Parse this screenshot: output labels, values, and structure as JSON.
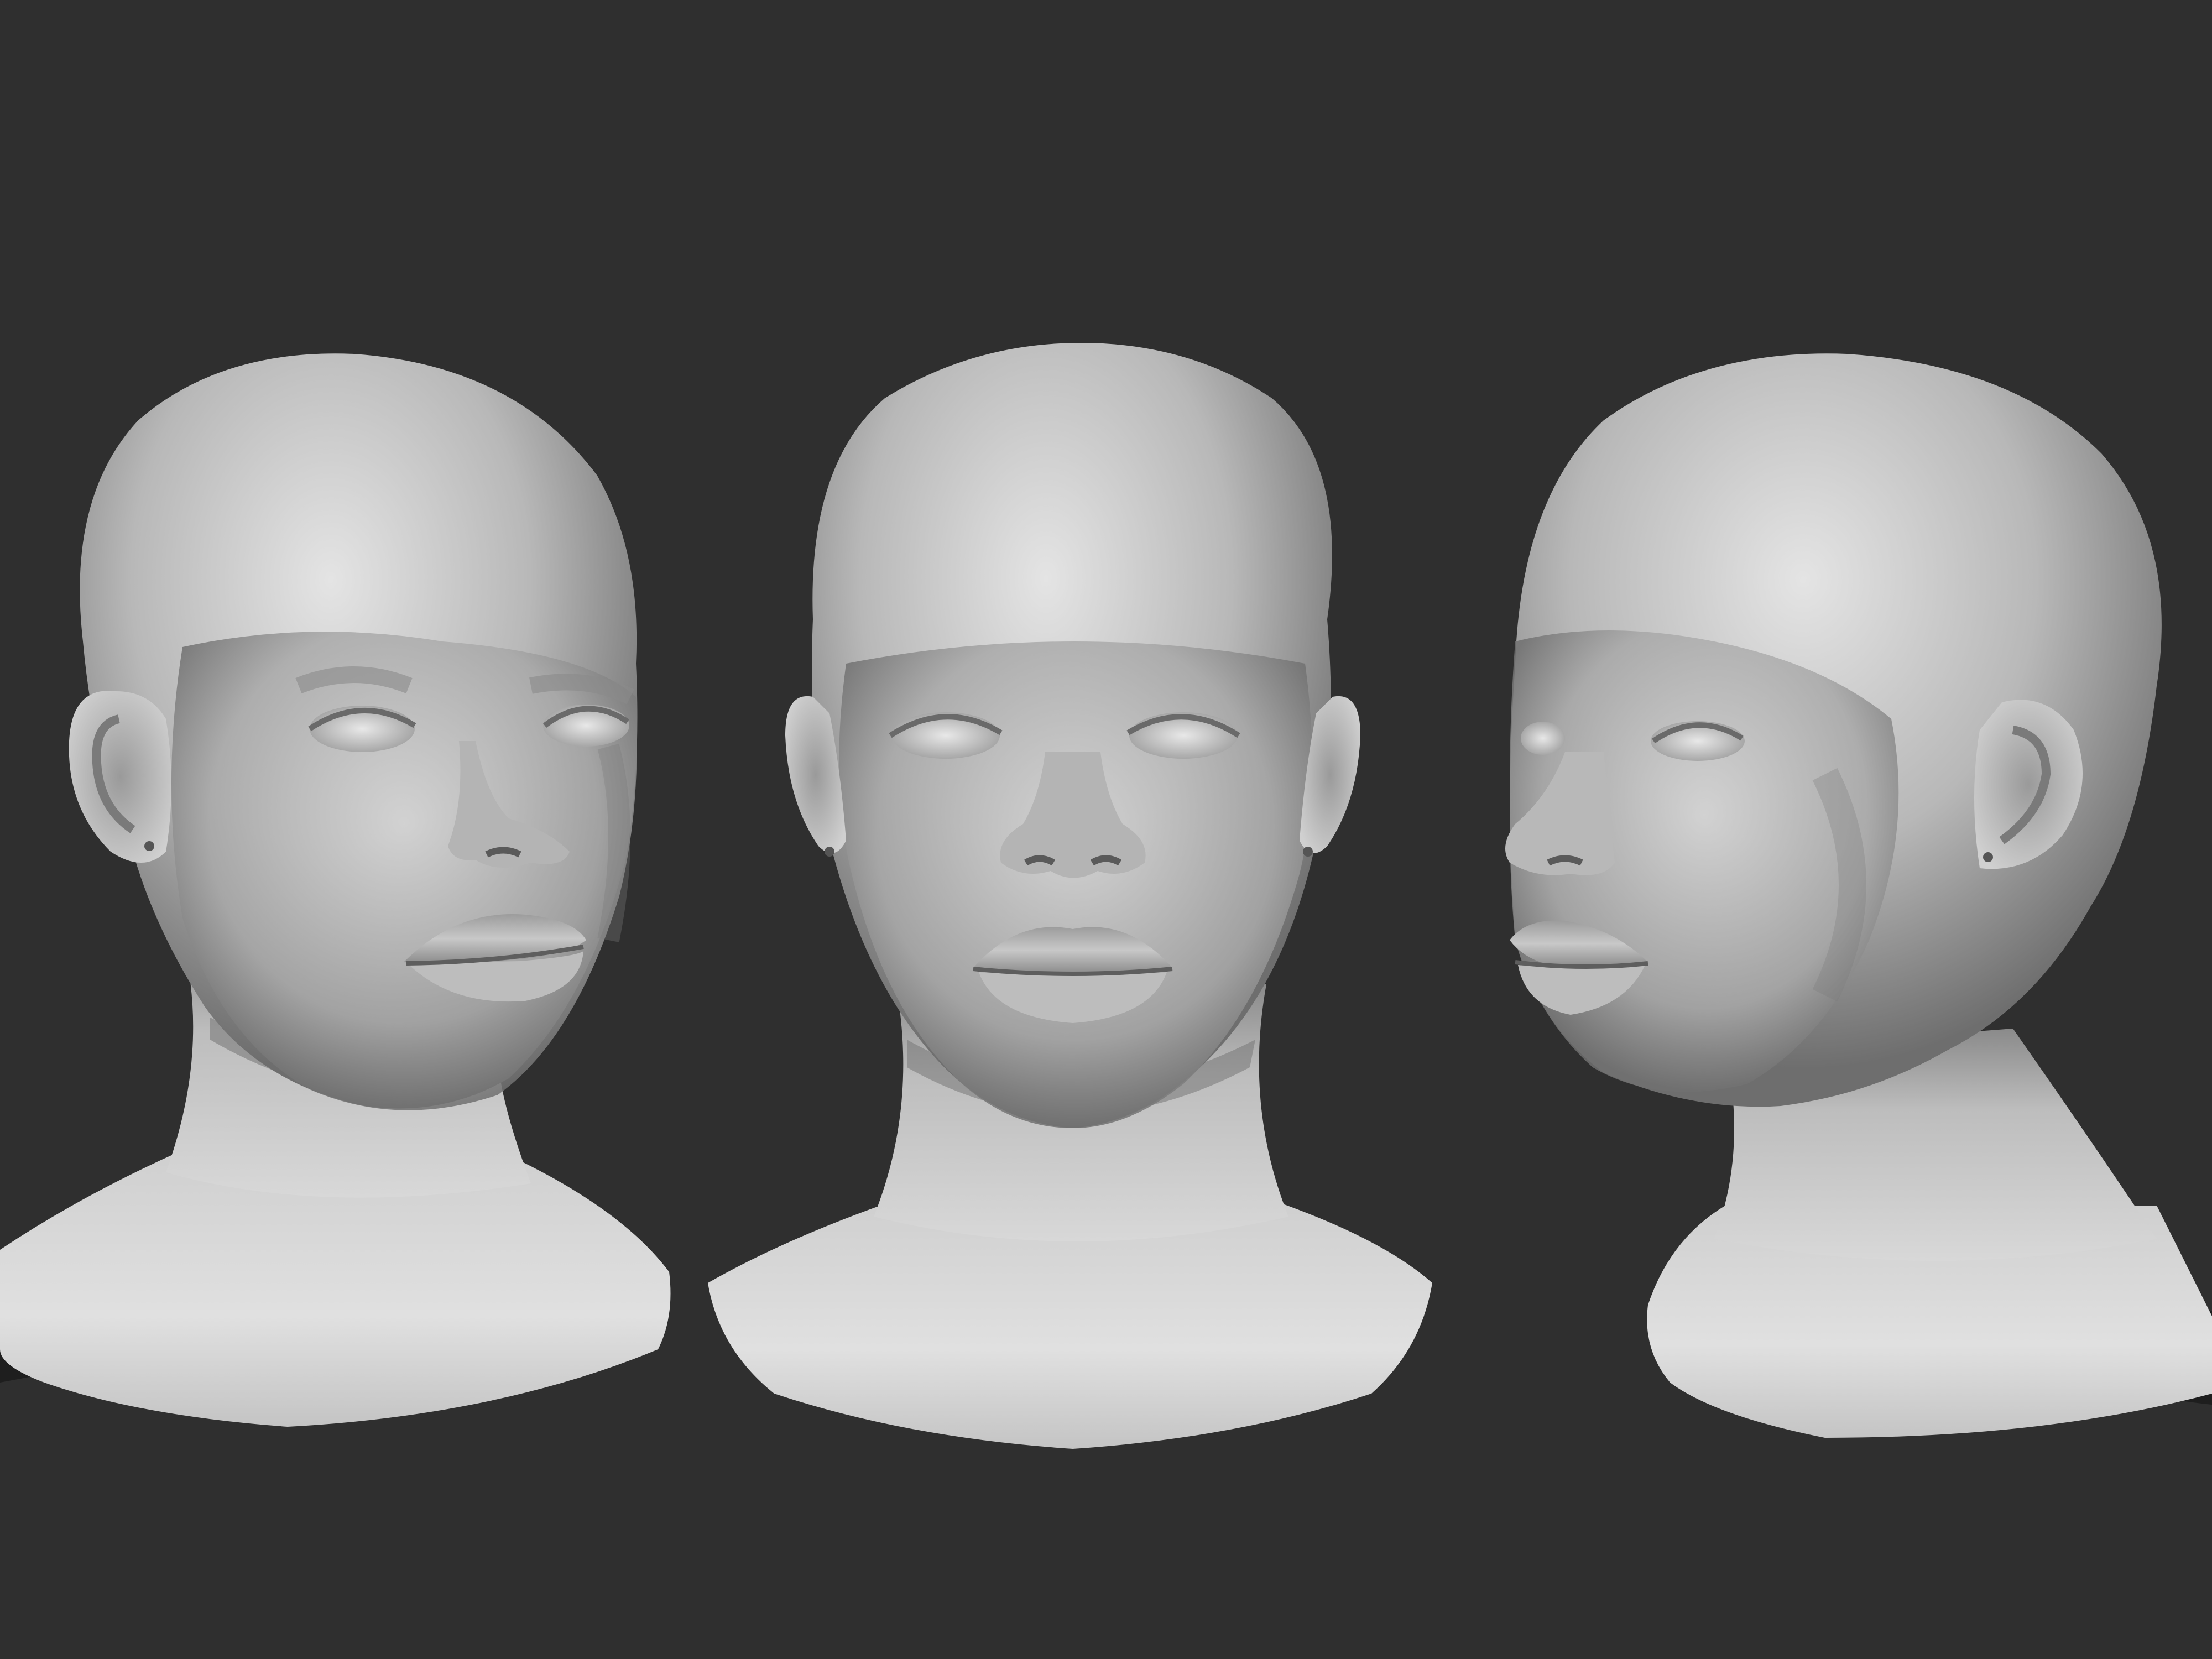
{
  "scene": {
    "background": "#2f2f2f",
    "clay_light": "#dcdcdc",
    "clay_mid": "#a9a9a9",
    "clay_dark": "#5a5a5a",
    "cavity": "#444444"
  },
  "busts": [
    {
      "view": "three-quarter-left"
    },
    {
      "view": "front"
    },
    {
      "view": "three-quarter-right"
    }
  ]
}
